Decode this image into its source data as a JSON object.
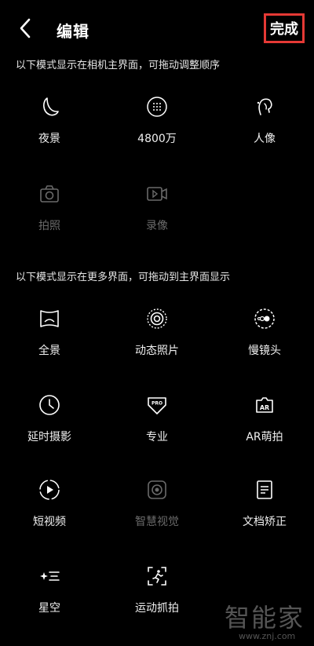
{
  "header": {
    "title": "编辑",
    "done_label": "完成"
  },
  "section1": {
    "title": "以下模式显示在相机主界面，可拖动调整顺序",
    "items": [
      {
        "label": "夜景",
        "icon": "moon-icon"
      },
      {
        "label": "4800万",
        "icon": "48mp-icon"
      },
      {
        "label": "人像",
        "icon": "portrait-icon"
      },
      {
        "label": "拍照",
        "icon": "camera-icon"
      },
      {
        "label": "录像",
        "icon": "video-icon"
      }
    ]
  },
  "section2": {
    "title": "以下模式显示在更多界面，可拖动到主界面显示",
    "items": [
      {
        "label": "全景",
        "icon": "panorama-icon"
      },
      {
        "label": "动态照片",
        "icon": "live-photo-icon"
      },
      {
        "label": "慢镜头",
        "icon": "slow-motion-icon"
      },
      {
        "label": "延时摄影",
        "icon": "timelapse-icon"
      },
      {
        "label": "专业",
        "icon": "pro-icon"
      },
      {
        "label": "AR萌拍",
        "icon": "ar-icon"
      },
      {
        "label": "短视频",
        "icon": "short-video-icon"
      },
      {
        "label": "智慧视觉",
        "icon": "smart-vision-icon"
      },
      {
        "label": "文档矫正",
        "icon": "document-icon"
      },
      {
        "label": "星空",
        "icon": "starry-sky-icon"
      },
      {
        "label": "运动抓拍",
        "icon": "sport-capture-icon"
      }
    ]
  },
  "watermark": {
    "brand": "智能家",
    "url": "www.znj.com"
  },
  "colors": {
    "background": "#000000",
    "highlight_border": "#e53935",
    "disabled": "#6a6a6a"
  }
}
